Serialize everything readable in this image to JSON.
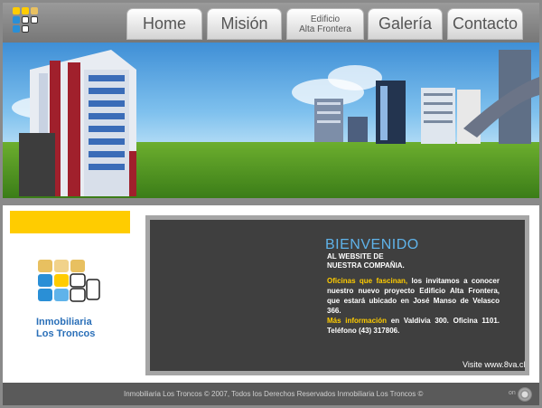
{
  "nav": {
    "tabs": [
      {
        "label": "Home"
      },
      {
        "label": "Misión"
      },
      {
        "line1": "Edificio",
        "line2": "Alta Frontera"
      },
      {
        "label": "Galería"
      },
      {
        "label": "Contacto"
      }
    ]
  },
  "brand": {
    "line1": "Inmobiliaria",
    "line2": "Los Troncos",
    "colors": {
      "yellow": "#ffcc00",
      "blue": "#2a6fb8",
      "light_blue": "#5fb3ea"
    }
  },
  "content": {
    "welcome": "BIENVENIDO",
    "intro": "AL WEBSITE DE NUESTRA COMPAÑIA.",
    "highlight1": "Oficinas que fascinan,",
    "para1": " los invitamos a conocer nuestro nuevo proyecto Edificio Alta Frontera, que estará ubicado en José Manso de Velasco 366.",
    "highlight2": "Más información",
    "para2": " en Valdivia 300. Oficina 1101. Teléfono (43) 317806.",
    "visit": "Visite www.8va.cl"
  },
  "footer": {
    "text": "Inmobiliaria Los Troncos © 2007, Todos los Derechos Reservados Inmobiliaria Los Troncos ©",
    "on_label": "on"
  }
}
